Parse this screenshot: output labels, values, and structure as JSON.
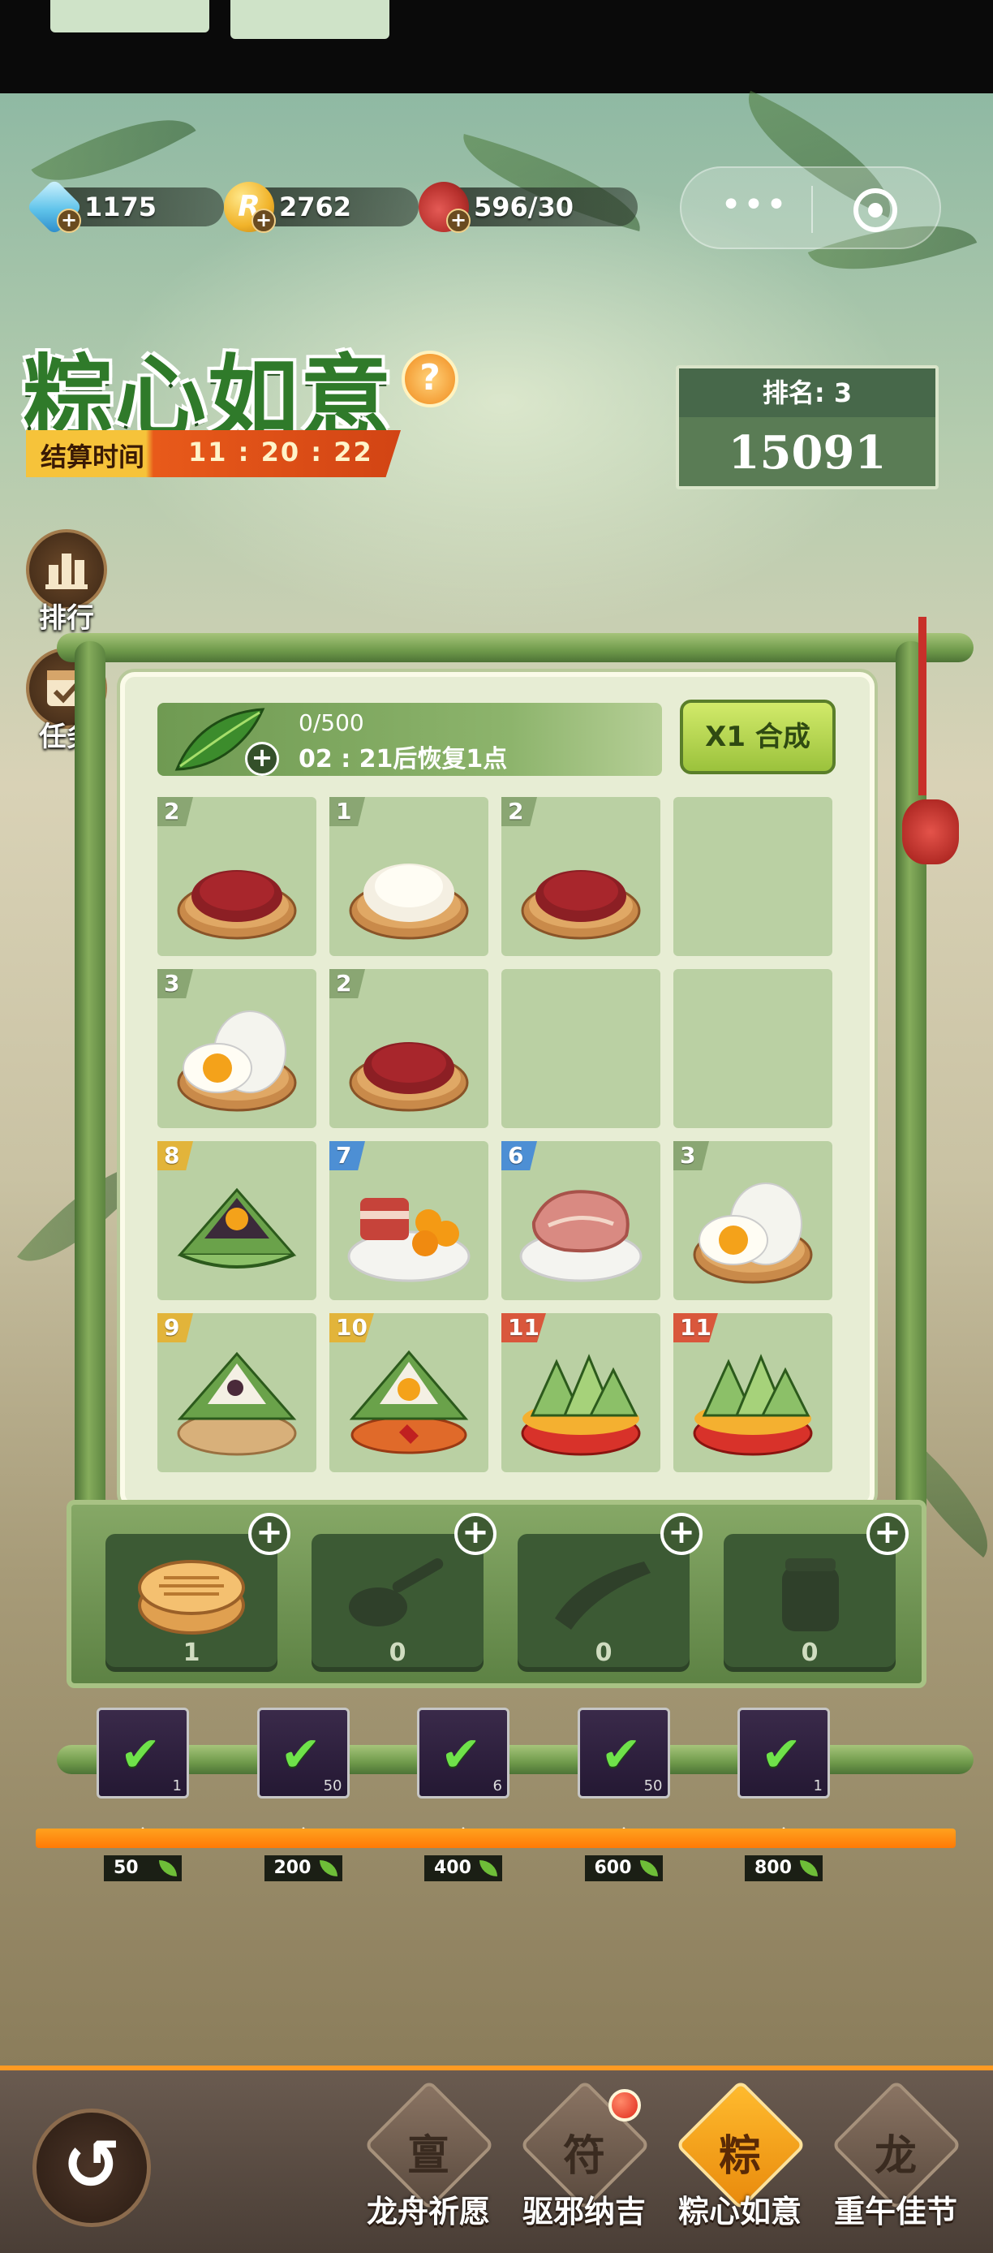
{
  "resources": {
    "diamonds": "1175",
    "coins": "2762",
    "stamina": "596/30"
  },
  "capsule": {
    "more": "•••"
  },
  "event": {
    "title": "粽心如意",
    "help": "?",
    "timer_label": "结算时间",
    "timer_value": "11 : 20 : 22",
    "rank_label": "排名: 3",
    "score": "15091"
  },
  "side": {
    "ranking": "排行",
    "tasks": "任务"
  },
  "energy": {
    "count": "0/500",
    "recover": "02 : 21后恢复1点",
    "plus": "+"
  },
  "merge_button": "X1 合成",
  "grid": [
    {
      "level": "2",
      "item": "red-bean-plate-icon",
      "color": "green"
    },
    {
      "level": "1",
      "item": "rice-plate-icon",
      "color": "green"
    },
    {
      "level": "2",
      "item": "red-bean-plate-icon",
      "color": "green"
    },
    {
      "level": "",
      "item": "",
      "color": ""
    },
    {
      "level": "3",
      "item": "salted-egg-icon",
      "color": "green"
    },
    {
      "level": "2",
      "item": "red-bean-plate-icon",
      "color": "green"
    },
    {
      "level": "",
      "item": "",
      "color": ""
    },
    {
      "level": "",
      "item": "",
      "color": ""
    },
    {
      "level": "8",
      "item": "yolk-zongzi-icon",
      "color": "yellow"
    },
    {
      "level": "7",
      "item": "pork-yolk-plate-icon",
      "color": "blue"
    },
    {
      "level": "6",
      "item": "pork-steak-icon",
      "color": "blue"
    },
    {
      "level": "3",
      "item": "salted-egg-icon",
      "color": "green"
    },
    {
      "level": "9",
      "item": "bean-zongzi-icon",
      "color": "yellow"
    },
    {
      "level": "10",
      "item": "premium-zongzi-icon",
      "color": "yellow"
    },
    {
      "level": "11",
      "item": "zongzi-basket-icon",
      "color": "red"
    },
    {
      "level": "11",
      "item": "zongzi-basket-icon",
      "color": "red"
    }
  ],
  "tools": [
    {
      "name": "steamer-icon",
      "count": "1"
    },
    {
      "name": "spatula-icon",
      "count": "0"
    },
    {
      "name": "paddle-icon",
      "count": "0"
    },
    {
      "name": "tea-jar-icon",
      "count": "0"
    }
  ],
  "rewards": [
    {
      "threshold": "50",
      "qty": "1",
      "checked": true
    },
    {
      "threshold": "200",
      "qty": "50",
      "checked": true
    },
    {
      "threshold": "400",
      "qty": "6",
      "checked": true
    },
    {
      "threshold": "600",
      "qty": "50",
      "checked": true
    },
    {
      "threshold": "800",
      "qty": "1",
      "checked": true
    }
  ],
  "nav": {
    "back": "↺",
    "items": [
      {
        "label": "龙舟祈愿",
        "glyph": "亶"
      },
      {
        "label": "驱邪纳吉",
        "glyph": "符"
      },
      {
        "label": "粽心如意",
        "glyph": "粽"
      },
      {
        "label": "重午佳节",
        "glyph": "龙"
      }
    ]
  },
  "colors": {
    "accent_orange": "#ff8a10",
    "title_green": "#2f7a2a",
    "panel_bg": "#e7edd4"
  }
}
